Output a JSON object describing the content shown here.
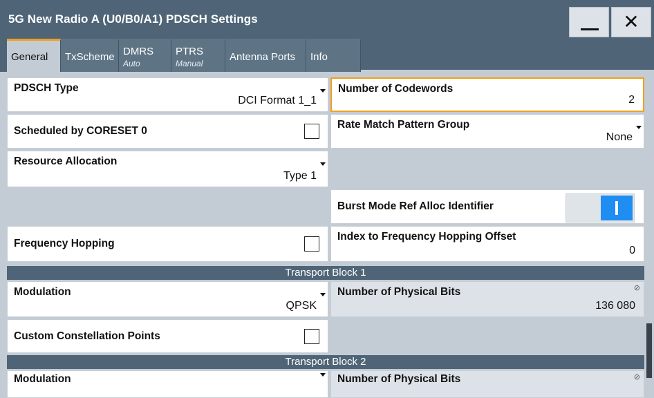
{
  "window": {
    "title": "5G New Radio A (U0/B0/A1) PDSCH Settings",
    "minimize_label": "",
    "close_label": "✕"
  },
  "tabs": [
    {
      "label": "General",
      "sub": ""
    },
    {
      "label": "TxScheme",
      "sub": ""
    },
    {
      "label": "DMRS",
      "sub": "Auto"
    },
    {
      "label": "PTRS",
      "sub": "Manual"
    },
    {
      "label": "Antenna Ports",
      "sub": ""
    },
    {
      "label": "Info",
      "sub": ""
    }
  ],
  "fields": {
    "pdsch_type": {
      "label": "PDSCH Type",
      "value": "DCI Format 1_1"
    },
    "num_codewords": {
      "label": "Number of Codewords",
      "value": "2"
    },
    "scheduled_coreset0": {
      "label": "Scheduled by CORESET 0",
      "checked": false
    },
    "rate_match": {
      "label": "Rate Match Pattern Group",
      "value": "None"
    },
    "resource_alloc": {
      "label": "Resource Allocation",
      "value": "Type 1"
    },
    "burst_mode": {
      "label": "Burst Mode Ref Alloc Identifier",
      "on": true
    },
    "freq_hopping": {
      "label": "Frequency Hopping",
      "checked": false
    },
    "freq_hop_offset": {
      "label": "Index to Frequency Hopping Offset",
      "value": "0"
    }
  },
  "transport_block_1": {
    "header": "Transport Block 1",
    "modulation": {
      "label": "Modulation",
      "value": "QPSK"
    },
    "phys_bits": {
      "label": "Number of Physical Bits",
      "value": "136 080"
    },
    "custom_constellation": {
      "label": "Custom Constellation Points",
      "checked": false
    }
  },
  "transport_block_2": {
    "header": "Transport Block 2",
    "modulation": {
      "label": "Modulation"
    },
    "phys_bits": {
      "label": "Number of Physical Bits"
    }
  },
  "colors": {
    "accent": "#f0a01e",
    "titlebar": "#4f6577",
    "toggle_on": "#1f8df1",
    "panel": "#c3ccd5"
  },
  "icons": {
    "readonly": "readonly-icon",
    "dropdown": "dropdown-arrow-icon"
  }
}
